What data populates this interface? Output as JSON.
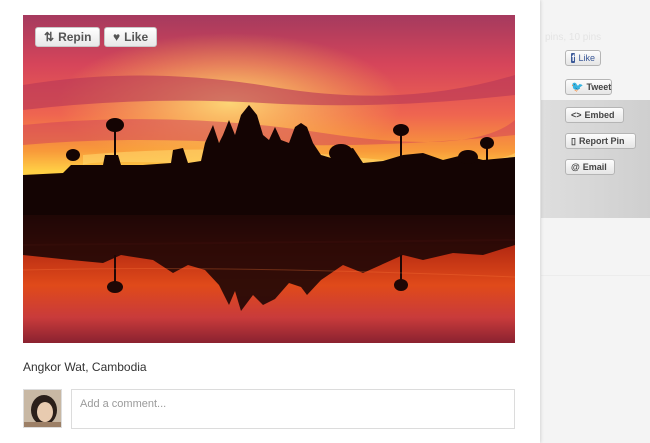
{
  "pin": {
    "repin_label": "Repin",
    "like_label": "Like",
    "caption": "Angkor Wat, Cambodia",
    "comment_placeholder": "Add a comment..."
  },
  "sidebar": {
    "faint_text": "pins, 10 pins",
    "facebook_like_label": "Like",
    "tweet_label": "Tweet",
    "embed_label": "Embed",
    "report_label": "Report Pin",
    "email_label": "Email"
  },
  "icons": {
    "repin": "repin-icon",
    "like": "heart-icon",
    "facebook": "facebook-icon",
    "twitter": "twitter-bird-icon",
    "embed": "embed-code-icon",
    "report": "flag-icon",
    "email": "at-sign-icon"
  },
  "colors": {
    "facebook": "#3b5998",
    "twitter": "#33aaff"
  }
}
